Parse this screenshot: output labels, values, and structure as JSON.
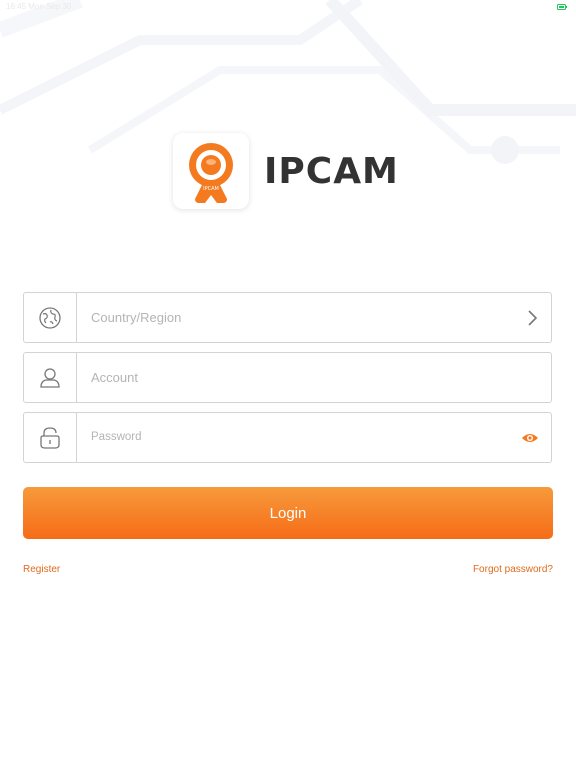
{
  "status_bar": {
    "time": "16:45  Mon Sep 30",
    "battery_color": "#22c55e"
  },
  "brand": {
    "logo_icon": "webcam-logo-icon",
    "logo_text": "IPCAM",
    "title": "IPCAM"
  },
  "form": {
    "country": {
      "placeholder": "Country/Region",
      "icon": "globe-icon",
      "right_icon": "chevron-right-icon"
    },
    "account": {
      "placeholder": "Account",
      "icon": "user-icon"
    },
    "password": {
      "placeholder": "Password",
      "icon": "lock-icon",
      "right_icon": "eye-icon"
    }
  },
  "actions": {
    "login_label": "Login",
    "register_label": "Register",
    "forgot_label": "Forgot password?"
  },
  "colors": {
    "accent": "#f47a20",
    "button_top": "#f79a3d",
    "button_bottom": "#f66c16",
    "link": "#e06a1c"
  }
}
